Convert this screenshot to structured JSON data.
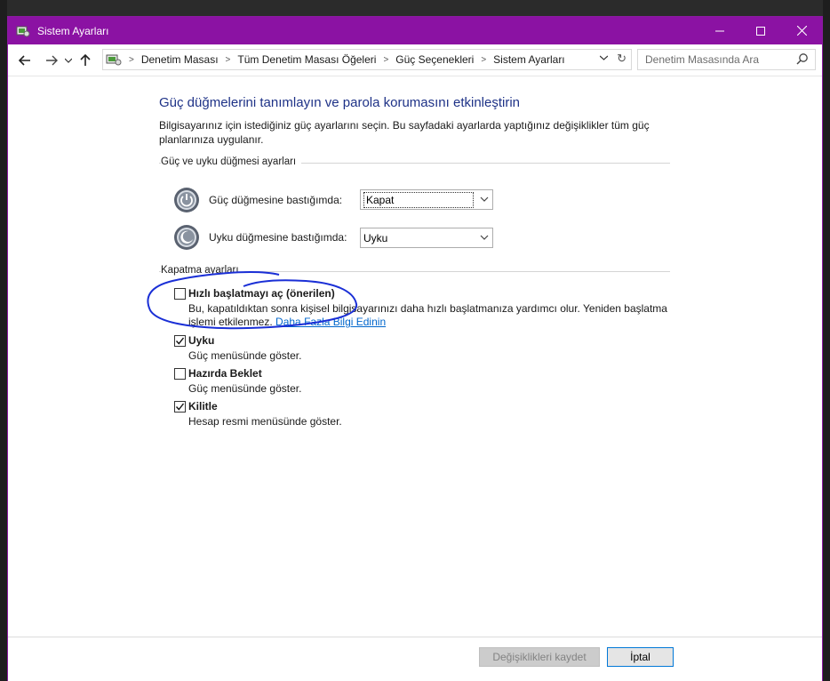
{
  "window": {
    "title": "Sistem Ayarları",
    "controls": {
      "minimize": "—",
      "maximize": "☐",
      "close": "✕"
    }
  },
  "nav": {
    "back": "←",
    "forward": "→",
    "dropdown": "⌄",
    "up": "↑",
    "breadcrumbs": [
      "Denetim Masası",
      "Tüm Denetim Masası Öğeleri",
      "Güç Seçenekleri",
      "Sistem Ayarları"
    ],
    "refresh": "↻",
    "search_placeholder": "Denetim Masasında Ara"
  },
  "main": {
    "heading": "Güç düğmelerini tanımlayın ve parola korumasını etkinleştirin",
    "description": "Bilgisayarınız için istediğiniz güç ayarlarını seçin. Bu sayfadaki ayarlarda yaptığınız değişiklikler tüm güç planlarınıza uygulanır.",
    "power_group": {
      "title": "Güç ve uyku düğmesi ayarları",
      "rows": [
        {
          "label": "Güç düğmesine bastığımda:",
          "value": "Kapat"
        },
        {
          "label": "Uyku düğmesine bastığımda:",
          "value": "Uyku"
        }
      ]
    },
    "shutdown_group": {
      "title": "Kapatma ayarları",
      "options": [
        {
          "label": "Hızlı başlatmayı aç (önerilen)",
          "checked": false,
          "desc_line1": "Bu, kapatıldıktan sonra kişisel bilgisayarınızı daha hızlı başlatmanıza yardımcı olur. Yeniden başlatma",
          "desc_line2": "işlemi etkilenmez.",
          "link": "Daha Fazla Bilgi Edinin"
        },
        {
          "label": "Uyku",
          "checked": true,
          "desc": "Güç menüsünde göster."
        },
        {
          "label": "Hazırda Beklet",
          "checked": false,
          "desc": "Güç menüsünde göster."
        },
        {
          "label": "Kilitle",
          "checked": true,
          "desc": "Hesap resmi menüsünde göster."
        }
      ]
    }
  },
  "footer": {
    "save_label": "Değişiklikleri kaydet",
    "cancel_label": "İptal"
  },
  "colors": {
    "titlebar": "#8b12a3",
    "heading": "#1e3287",
    "link": "#0066cc",
    "annotation": "#1a2fd6"
  }
}
